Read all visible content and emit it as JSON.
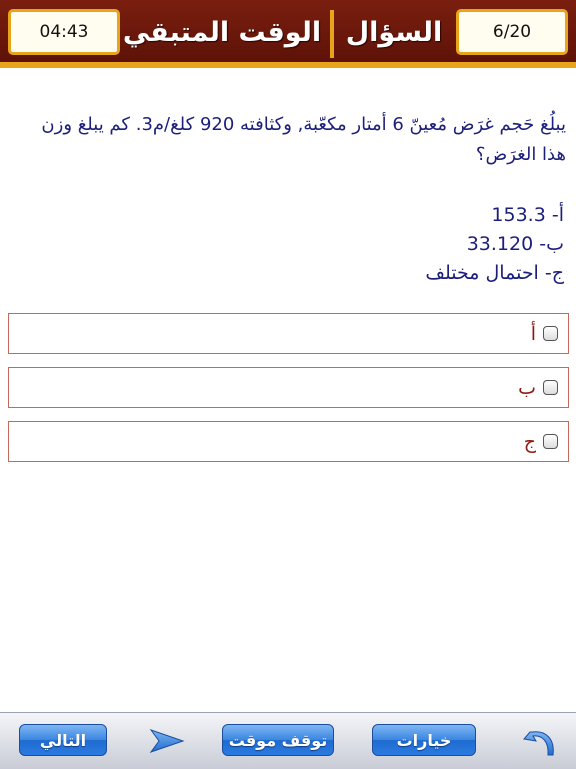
{
  "header": {
    "question_counter": "6/20",
    "question_title": "السؤال",
    "time_title": "الوقت المتبقي",
    "time_value": "04:43"
  },
  "question": {
    "text": "يبلُغ حَجم غرَض مُعينّ 6 أمتار مكعّبة, وكثافته 920 كلغ/م3. كم يبلغ وزن هذا الغرَض؟",
    "choices": [
      "أ- 153.3",
      "ب- 33.120",
      "ج- احتمال مختلف"
    ]
  },
  "answers": [
    {
      "label": "أ"
    },
    {
      "label": "ب"
    },
    {
      "label": "ج"
    }
  ],
  "toolbar": {
    "next_label": "التالي",
    "pause_label": "توقف موقت",
    "options_label": "خيارات",
    "next_arrow_icon": "play-arrow-icon",
    "back_icon": "back-arrow-icon"
  },
  "colors": {
    "header_bg": "#6b1a0c",
    "header_accent": "#e8a51c",
    "question_text": "#1c1f7a",
    "answer_border": "#c46a5d",
    "answer_label": "#8b1a10",
    "button_blue": "#2b7ae0"
  }
}
